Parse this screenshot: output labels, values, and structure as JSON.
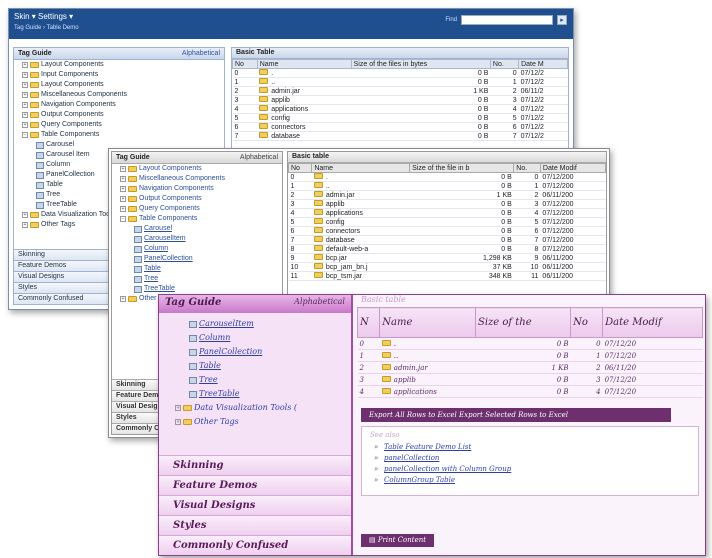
{
  "win1": {
    "nav": "Skin ▾   Settings ▾",
    "breadcrumb": "Tag Guide › Table Demo",
    "search_label": "Find",
    "panel_title": "Tag Guide",
    "alpha_link": "Alphabetical",
    "tree": [
      "Layout Components",
      "Input Components",
      "Layout Components",
      "Miscellaneous Components",
      "Navigation Components",
      "Output Components",
      "Query Components",
      "Table Components",
      "Carousel",
      "Carousel Item",
      "Column",
      "PanelCollection",
      "Table",
      "Tree",
      "TreeTable",
      "Data Visualization Tools",
      "Other Tags"
    ],
    "accordion": [
      "Skinning",
      "Feature Demos",
      "Visual Designs",
      "Styles",
      "Commonly Confused"
    ],
    "table_title": "Basic Table",
    "columns": [
      "No",
      "Name",
      "Size of the files in bytes",
      "No.",
      "Date M"
    ],
    "rows": [
      [
        "0",
        "",
        ".",
        "0 B",
        "0",
        "07/12/2"
      ],
      [
        "1",
        "",
        "..",
        "0 B",
        "1",
        "07/12/2"
      ],
      [
        "2",
        "",
        "admin.jar",
        "1 KB",
        "2",
        "06/11/2"
      ],
      [
        "3",
        "",
        "applib",
        "0 B",
        "3",
        "07/12/2"
      ],
      [
        "4",
        "",
        "applications",
        "0 B",
        "4",
        "07/12/2"
      ],
      [
        "5",
        "",
        "config",
        "0 B",
        "5",
        "07/12/2"
      ],
      [
        "6",
        "",
        "connectors",
        "0 B",
        "6",
        "07/12/2"
      ],
      [
        "7",
        "",
        "database",
        "0 B",
        "7",
        "07/12/2"
      ]
    ]
  },
  "win2": {
    "panel_title": "Tag Guide",
    "alpha_link": "Alphabetical",
    "tree": [
      "Layout Components",
      "Miscellaneous Components",
      "Navigation Components",
      "Output Components",
      "Query Components",
      "Table Components",
      "Carousel",
      "CarouselItem",
      "Column",
      "PanelCollection",
      "Table",
      "Tree",
      "TreeTable",
      "Other Tags"
    ],
    "accordion": [
      "Skinning",
      "Feature Demos",
      "Visual Designs",
      "Styles",
      "Commonly Confused"
    ],
    "table_title": "Basic table",
    "columns": [
      "No",
      "Name",
      "Size of the file in b",
      "No.",
      "Date Modif"
    ],
    "rows": [
      [
        "0",
        "",
        ".",
        "0 B",
        "0",
        "07/12/200"
      ],
      [
        "1",
        "",
        "..",
        "0 B",
        "1",
        "07/12/200"
      ],
      [
        "2",
        "",
        "admin.jar",
        "1 KB",
        "2",
        "06/11/200"
      ],
      [
        "3",
        "",
        "applib",
        "0 B",
        "3",
        "07/12/200"
      ],
      [
        "4",
        "",
        "applications",
        "0 B",
        "4",
        "07/12/200"
      ],
      [
        "5",
        "",
        "config",
        "0 B",
        "5",
        "07/12/200"
      ],
      [
        "6",
        "",
        "connectors",
        "0 B",
        "6",
        "07/12/200"
      ],
      [
        "7",
        "",
        "database",
        "0 B",
        "7",
        "07/12/200"
      ],
      [
        "8",
        "",
        "default-web-a",
        "0 B",
        "8",
        "07/12/200"
      ],
      [
        "9",
        "",
        "bcp.jar",
        "1,298 KB",
        "9",
        "06/11/200"
      ],
      [
        "10",
        "",
        "bcp_jam_bn.j",
        "37 KB",
        "10",
        "06/11/200"
      ],
      [
        "11",
        "",
        "bcp_tsm.jar",
        "348 KB",
        "11",
        "06/11/200"
      ]
    ]
  },
  "win3": {
    "panel_title": "Tag Guide",
    "alpha_link": "Alphabetical",
    "tree": [
      "CarouselItem",
      "Column",
      "PanelCollection",
      "Table",
      "Tree",
      "TreeTable",
      "Data Visualization Tools (",
      "Other Tags"
    ],
    "accordion": [
      "Skinning",
      "Feature Demos",
      "Visual Designs",
      "Styles",
      "Commonly Confused"
    ],
    "table_title": "Basic table",
    "columns": [
      "N",
      "Name",
      "Size of the",
      "No",
      "Date Modif"
    ],
    "rows": [
      [
        "0",
        "",
        ".",
        "0 B",
        "0",
        "07/12/20"
      ],
      [
        "1",
        "",
        "..",
        "0 B",
        "1",
        "07/12/20"
      ],
      [
        "2",
        "",
        "admin.jar",
        "1 KB",
        "2",
        "06/11/20"
      ],
      [
        "3",
        "",
        "applib",
        "0 B",
        "3",
        "07/12/20"
      ],
      [
        "4",
        "",
        "applications",
        "0 B",
        "4",
        "07/12/20"
      ]
    ],
    "export_text": "Export All Rows to Excel  Export Selected Rows to Excel",
    "links_title": "See also",
    "links": [
      "Table Feature Demo List",
      "panelCollection",
      "panelCollection with Column Group",
      "ColumnGroup Table"
    ],
    "print_label": "Print Content"
  }
}
